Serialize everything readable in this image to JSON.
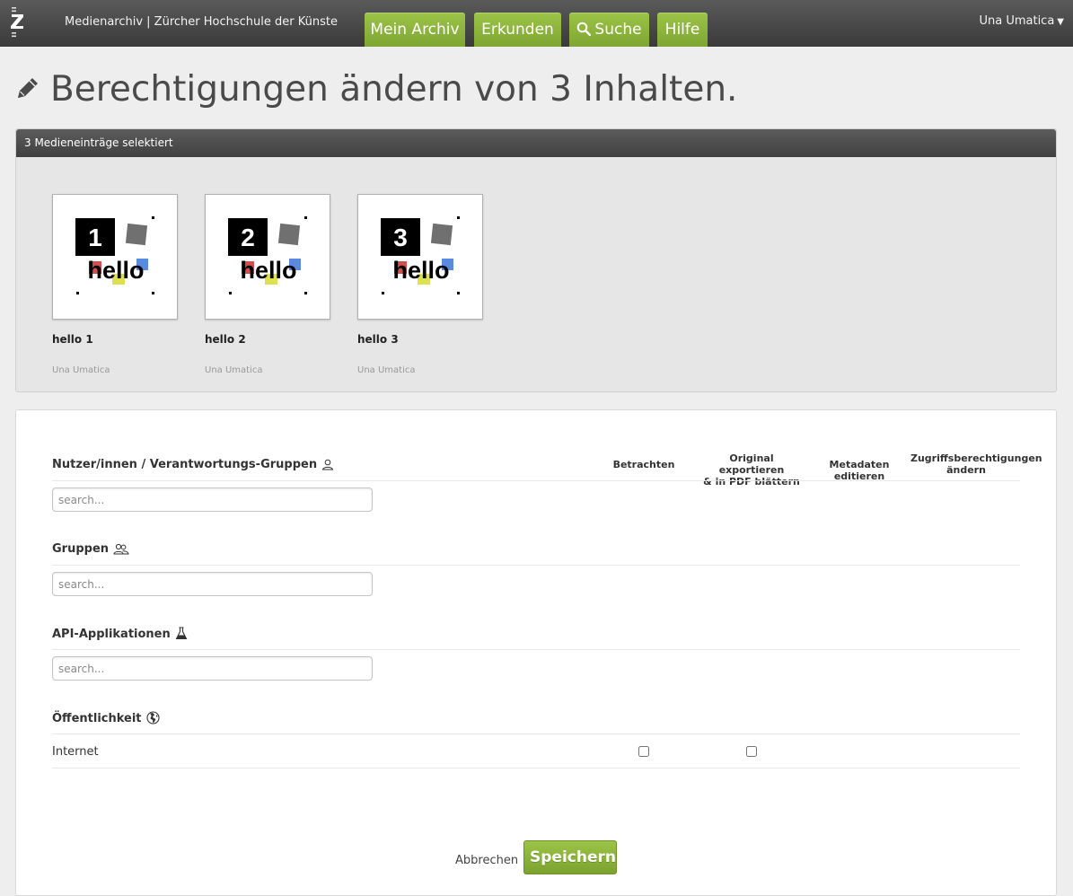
{
  "header": {
    "brand": "Medienarchiv | Zürcher Hochschule der Künste",
    "tabs": [
      {
        "label": "Mein Archiv"
      },
      {
        "label": "Erkunden"
      },
      {
        "label": "Suche",
        "icon": "search-icon"
      },
      {
        "label": "Hilfe"
      }
    ],
    "user": "Una Umatica",
    "colors": {
      "accent": "#8db43c",
      "bar": "#4a4a4a"
    }
  },
  "page": {
    "title": "Berechtigungen ändern von 3 Inhalten.",
    "title_icon": "pencil-icon"
  },
  "selection": {
    "header": "3 Medieneinträge selektiert",
    "items": [
      {
        "number": "1",
        "word": "hello",
        "title": "hello 1",
        "owner": "Una Umatica"
      },
      {
        "number": "2",
        "word": "hello",
        "title": "hello 2",
        "owner": "Una Umatica"
      },
      {
        "number": "3",
        "word": "hello",
        "title": "hello 3",
        "owner": "Una Umatica"
      }
    ]
  },
  "permissions": {
    "columns": {
      "view": "Betrachten",
      "export_1": "Original exportieren",
      "export_2": "& in PDF blättern",
      "edit": "Metadaten editieren",
      "manage_1": "Zugriffsberechtigungen",
      "manage_2": "ändern"
    },
    "sections": {
      "users": {
        "label": "Nutzer/innen / Verantwortungs-Gruppen",
        "icon": "user-icon",
        "placeholder": "search..."
      },
      "groups": {
        "label": "Gruppen",
        "icon": "group-icon",
        "placeholder": "search..."
      },
      "api": {
        "label": "API-Applikationen",
        "icon": "flask-icon",
        "placeholder": "search..."
      },
      "public": {
        "label": "Öffentlichkeit",
        "icon": "globe-icon"
      }
    },
    "public_row": {
      "label": "Internet",
      "view": false,
      "export": false
    },
    "actions": {
      "cancel": "Abbrechen",
      "save": "Speichern"
    }
  }
}
